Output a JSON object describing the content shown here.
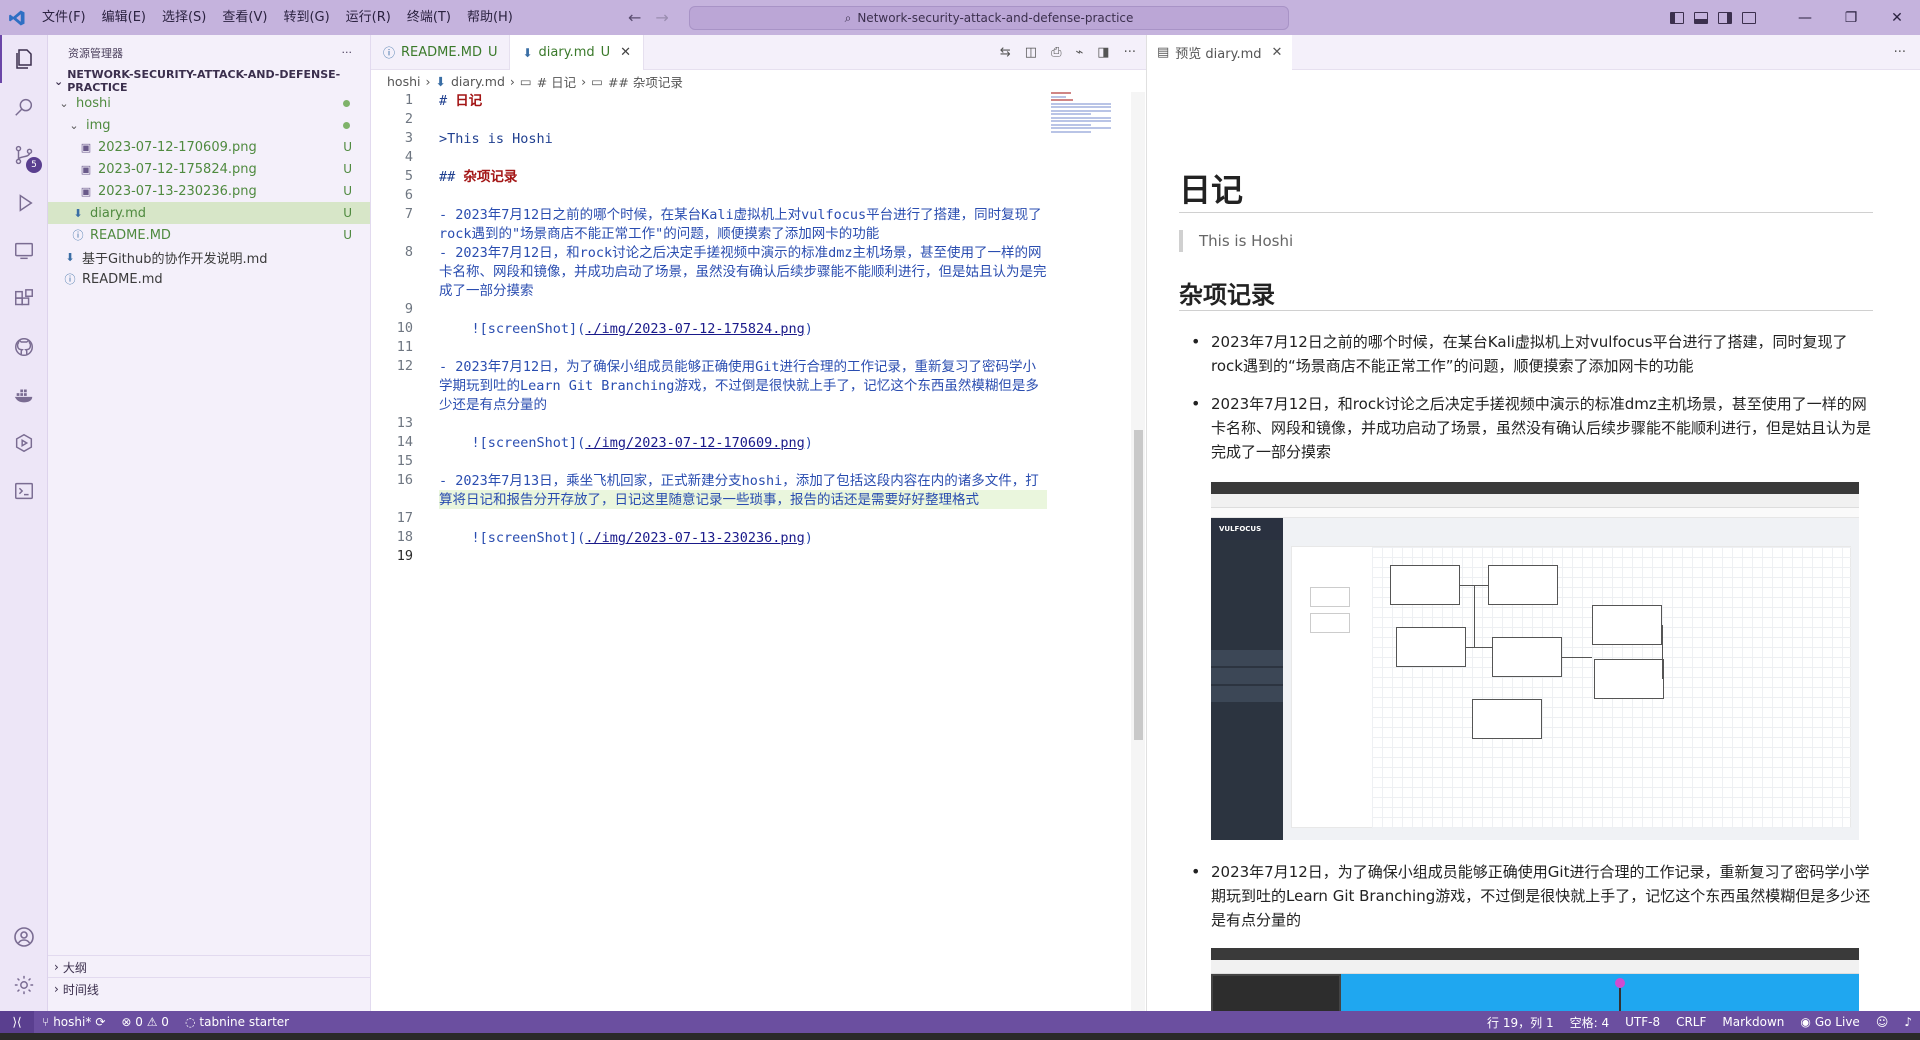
{
  "titlebar": {
    "menus": [
      "文件(F)",
      "编辑(E)",
      "选择(S)",
      "查看(V)",
      "转到(G)",
      "运行(R)",
      "终端(T)",
      "帮助(H)"
    ],
    "search": "Network-security-attack-and-defense-practice"
  },
  "activity": {
    "scm_badge": "5"
  },
  "explorer": {
    "title": "资源管理器",
    "workspace": "NETWORK-SECURITY-ATTACK-AND-DEFENSE-PRACTICE",
    "tree": {
      "hoshi": "hoshi",
      "img": "img",
      "png1": "2023-07-12-170609.png",
      "png2": "2023-07-12-175824.png",
      "png3": "2023-07-13-230236.png",
      "diary": "diary.md",
      "readme_inner": "README.MD",
      "github_doc": "基于Github的协作开发说明.md",
      "readme_root": "README.md",
      "git_u": "U"
    },
    "outline": "大纲",
    "timeline": "时间线"
  },
  "editor": {
    "tabs": [
      {
        "label": "README.MD",
        "status": "U"
      },
      {
        "label": "diary.md",
        "status": "U"
      }
    ],
    "breadcrumb": {
      "folder": "hoshi",
      "file": "diary.md",
      "h1": "# 日记",
      "h2": "## 杂项记录"
    },
    "line_numbers": [
      "1",
      "2",
      "3",
      "4",
      "5",
      "6",
      "7",
      "8",
      "9",
      "10",
      "11",
      "12",
      "13",
      "14",
      "15",
      "16",
      "17",
      "18",
      "19"
    ],
    "lines": {
      "l1_mark": "# ",
      "l1_text": "日记",
      "l3": ">This is Hoshi",
      "l5_mark": "## ",
      "l5_text": "杂项记录",
      "l7": "- 2023年7月12日之前的哪个时候，在某台Kali虚拟机上对vulfocus平台进行了搭建，同时复现了rock遇到的\"场景商店不能正常工作\"的问题，顺便摸索了添加网卡的功能",
      "l8": "- 2023年7月12日，和rock讨论之后决定手搓视频中演示的标准dmz主机场景，甚至使用了一样的网卡名称、网段和镜像，并成功启动了场景，虽然没有确认后续步骤能不能顺利进行，但是姑且认为是完成了一部分摸索",
      "l10_pre": "    ![screenShot](",
      "l10_path": "./img/2023-07-12-175824.png",
      "l10_post": ")",
      "l12": "- 2023年7月12日，为了确保小组成员能够正确使用Git进行合理的工作记录，重新复习了密码学小学期玩到吐的Learn Git Branching游戏，不过倒是很快就上手了，记忆这个东西虽然模糊但是多少还是有点分量的",
      "l14_pre": "    ![screenShot](",
      "l14_path": "./img/2023-07-12-170609.png",
      "l14_post": ")",
      "l16": "- 2023年7月13日，乘坐飞机回家，正式新建分支hoshi，添加了包括这段内容在内的诸多文件，打算将日记和报告分开存放了，日记这里随意记录一些琐事，报告的话还是需要好好整理格式",
      "l18_pre": "    ![screenShot](",
      "l18_path": "./img/2023-07-13-230236.png",
      "l18_post": ")"
    }
  },
  "preview": {
    "tab": "预览 diary.md",
    "h1": "日记",
    "quote": "This is Hoshi",
    "h2": "杂项记录",
    "items": [
      "2023年7月12日之前的哪个时候，在某台Kali虚拟机上对vulfocus平台进行了搭建，同时复现了rock遇到的“场景商店不能正常工作”的问题，顺便摸索了添加网卡的功能",
      "2023年7月12日，和rock讨论之后决定手搓视频中演示的标准dmz主机场景，甚至使用了一样的网卡名称、网段和镜像，并成功启动了场景，虽然没有确认后续步骤能不能顺利进行，但是姑且认为是完成了一部分摸索",
      "2023年7月12日，为了确保小组成员能够正确使用Git进行合理的工作记录，重新复习了密码学小学期玩到吐的Learn Git Branching游戏，不过倒是很快就上手了，记忆这个东西虽然模糊但是多少还是有点分量的"
    ],
    "shot1_logo": "VULFOCUS"
  },
  "statusbar": {
    "branch": "hoshi*",
    "problems": "⊗ 0 ⚠ 0",
    "tabnine": "tabnine starter",
    "position": "行 19，列 1",
    "spaces": "空格: 4",
    "encoding": "UTF-8",
    "eol": "CRLF",
    "language": "Markdown",
    "golive": "Go Live"
  },
  "colors": {
    "titlebar": "#c5b3dd",
    "statusbar": "#6b4fa0",
    "sidebar": "#f4f0fa",
    "selected_row": "#d7e6c8"
  }
}
